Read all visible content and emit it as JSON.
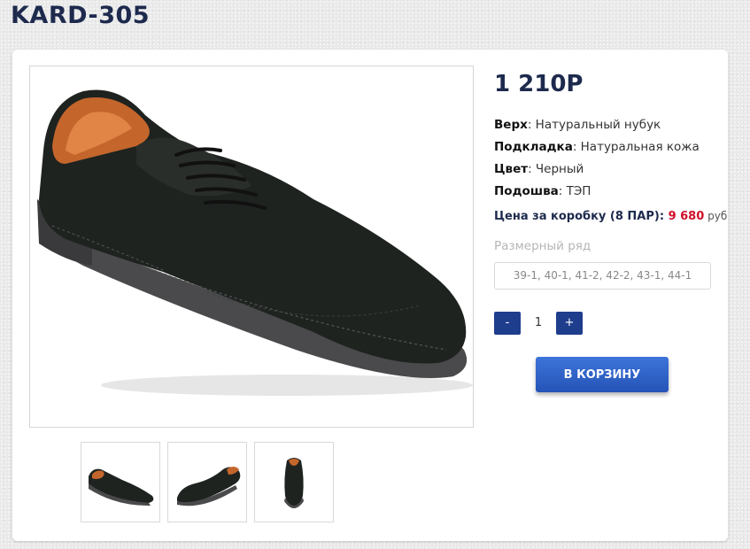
{
  "product": {
    "title": "KARD-305",
    "price": "1 210Р",
    "specs": [
      {
        "label": "Верх",
        "value": ": Натуральный нубук"
      },
      {
        "label": "Подкладка",
        "value": ": Натуральная кожа"
      },
      {
        "label": "Цвет",
        "value": ": Черный"
      },
      {
        "label": "Подошва",
        "value": ": ТЭП"
      }
    ],
    "box_price": {
      "label": "Цена за коробку (8 ПАР): ",
      "amount": "9 680",
      "currency": " руб"
    },
    "sizes": {
      "label": "Размерный ряд",
      "value": "39-1, 40-1, 41-2, 42-2, 43-1, 44-1"
    },
    "quantity": {
      "minus": "-",
      "value": "1",
      "plus": "+"
    },
    "cart_button": "В КОРЗИНУ"
  },
  "colors": {
    "accent": "#1e3d8c",
    "title": "#1d2a4d",
    "price_red": "#d0102a",
    "cart_button": "#2f63c8"
  }
}
